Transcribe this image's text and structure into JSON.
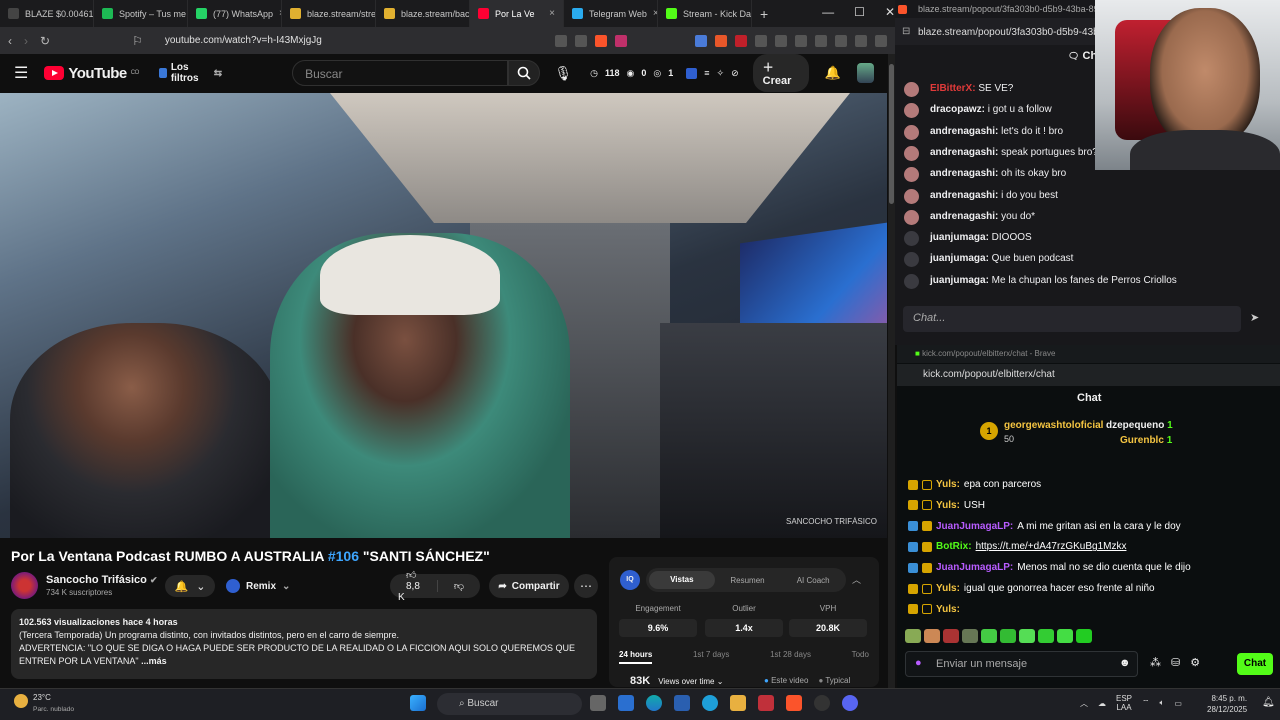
{
  "browser": {
    "tabs": [
      {
        "label": "BLAZE $0.0046160",
        "icon": "blaze-icon",
        "color": "#444"
      },
      {
        "label": "Spotify – Tus me",
        "icon": "spotify-icon",
        "color": "#1db954"
      },
      {
        "label": "(77) WhatsApp",
        "icon": "whatsapp-icon",
        "color": "#25d366"
      },
      {
        "label": "blaze.stream/stre",
        "icon": "blaze-icon",
        "color": "#e0b030"
      },
      {
        "label": "blaze.stream/bac",
        "icon": "blaze-icon",
        "color": "#e0b030"
      },
      {
        "label": "Por La Ve",
        "icon": "youtube-icon",
        "color": "#ff0033"
      },
      {
        "label": "Telegram Web",
        "icon": "telegram-icon",
        "color": "#2aabee"
      },
      {
        "label": "Stream - Kick Da",
        "icon": "kick-icon",
        "color": "#53fc18"
      }
    ],
    "url": "youtube.com/watch?v=h-I43MxjgJg"
  },
  "youtube": {
    "logo": "YouTube",
    "logo_country": "CO",
    "filters": "Los filtros",
    "search_placeholder": "Buscar",
    "stats": [
      "118",
      "0",
      "1"
    ],
    "create": "Crear",
    "watermark": "SANCOCHO TRIFÁSICO",
    "title_main": "Por La Ventana Podcast RUMBO A AUSTRALIA ",
    "title_tag": "#106",
    "title_end": " \"SANTI SÁNCHEZ\"",
    "channel": "Sancocho Trifásico",
    "subscribers": "734 K suscriptores",
    "remix": "Remix",
    "likes": "8,8 K",
    "share": "Compartir",
    "views_time": "102.563 visualizaciones  hace 4 horas",
    "desc_1": "(Tercera Temporada) Un programa distinto, con invitados distintos, pero en el carro de siempre.",
    "desc_2": "ADVERTENCIA: \"LO QUE SE DIGA O HAGA PUEDE SER PRODUCTO DE LA REALIDAD O LA FICCION AQUI SOLO QUEREMOS QUE ENTREN POR LA VENTANA\"",
    "desc_more": "...más"
  },
  "iq": {
    "logo": "IQ",
    "tabs": [
      "Vistas",
      "Resumen",
      "AI Coach"
    ],
    "metrics": [
      {
        "label": "Engagement",
        "value": "9.6%"
      },
      {
        "label": "Outlier",
        "value": "1.4x"
      },
      {
        "label": "VPH",
        "value": "20.8K"
      }
    ],
    "ranges": [
      "24 hours",
      "1st 7 days",
      "1st 28 days",
      "Todo"
    ],
    "views": "83K",
    "views_label": "Views over time",
    "legend": [
      "Este video",
      "Typical"
    ]
  },
  "blaze_popout": {
    "url_title": "blaze.stream/popout/3fa303b0-d5b9-43ba-89b5-96",
    "url": "blaze.stream/popout/3fa303b0-d5b9-43ba",
    "chat_label": "Chat",
    "messages": [
      {
        "user": "EIBitterX:",
        "text": " SE VE?",
        "color": "#e03a3a"
      },
      {
        "user": "dracopawz:",
        "text": " i got u a follow",
        "color": "#efeff1"
      },
      {
        "user": "andrenagashi:",
        "text": " let's do it ! bro",
        "color": "#efeff1"
      },
      {
        "user": "andrenagashi:",
        "text": " speak portugues bro?",
        "color": "#efeff1"
      },
      {
        "user": "andrenagashi:",
        "text": " oh its okay bro",
        "color": "#efeff1"
      },
      {
        "user": "andrenagashi:",
        "text": " i do you best",
        "color": "#efeff1"
      },
      {
        "user": "andrenagashi:",
        "text": " you do*",
        "color": "#efeff1"
      },
      {
        "user": "juanjumaga:",
        "text": " DIOOOS",
        "color": "#efeff1"
      },
      {
        "user": "juanjumaga:",
        "text": " Que buen podcast",
        "color": "#efeff1"
      },
      {
        "user": "juanjumaga:",
        "text": " Me la chupan los fanes de Perros Criollos",
        "color": "#efeff1"
      }
    ],
    "input_placeholder": "Chat..."
  },
  "kick": {
    "window_title": "kick.com/popout/elbitterx/chat - Brave",
    "url": "kick.com/popout/elbitterx/chat",
    "chat_label": "Chat",
    "top_user": "georgewashtoloficial",
    "top_amount": "50",
    "rank_1": "1",
    "gifters": [
      {
        "name": "dzepequeno",
        "count": "1"
      },
      {
        "name": "Gurenblc",
        "count": "1"
      }
    ],
    "messages": [
      {
        "user": "Yuls:",
        "text": " epa con parceros",
        "color": "#f5c542"
      },
      {
        "user": "Yuls:",
        "text": " USH",
        "color": "#f5c542"
      },
      {
        "user": "JuanJumagaLP:",
        "text": " A mi me gritan asi en la cara y le doy",
        "color": "#b85cff"
      },
      {
        "user": "BotRix:",
        "text": " https://t.me/+dA47rzGKuBg1Mzkx",
        "color": "#53fc18"
      },
      {
        "user": "JuanJumagaLP:",
        "text": " Menos mal no se dio cuenta que le dijo",
        "color": "#b85cff"
      },
      {
        "user": "Yuls:",
        "text": " igual que gonorrea hacer eso frente al niño",
        "color": "#f5c542"
      },
      {
        "user": "Yuls:",
        "text": "",
        "color": "#f5c542"
      }
    ],
    "input_placeholder": "Enviar un mensaje",
    "chat_button": "Chat"
  },
  "taskbar": {
    "temp": "23°C",
    "weather": "Parc. nublado",
    "search": "Buscar",
    "lang": "ESP",
    "lang2": "LAA",
    "time": "8:45 p. m.",
    "date": "28/12/2025"
  }
}
